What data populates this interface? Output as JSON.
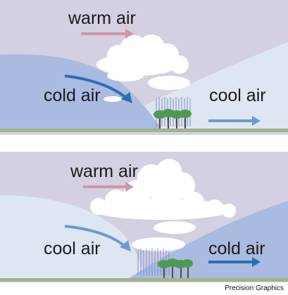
{
  "diagrams": [
    {
      "upper_label": "warm air",
      "left_label": "cold air",
      "right_label": "cool air"
    },
    {
      "upper_label": "warm air",
      "left_label": "cool air",
      "right_label": "cold air"
    }
  ],
  "credit": "Precision Graphics",
  "colors": {
    "sky": "#d4d0e2",
    "cold_air_mass": "#a9bbe0",
    "cool_air_mass": "#dfe6f3",
    "ground": "#9fb58a",
    "warm_arrow": "#cf95a6",
    "cold_arrow": "#2a6fb5",
    "cool_arrow": "#6f9acb",
    "rain": "#7d8fc8",
    "cloud": "#ffffff"
  }
}
